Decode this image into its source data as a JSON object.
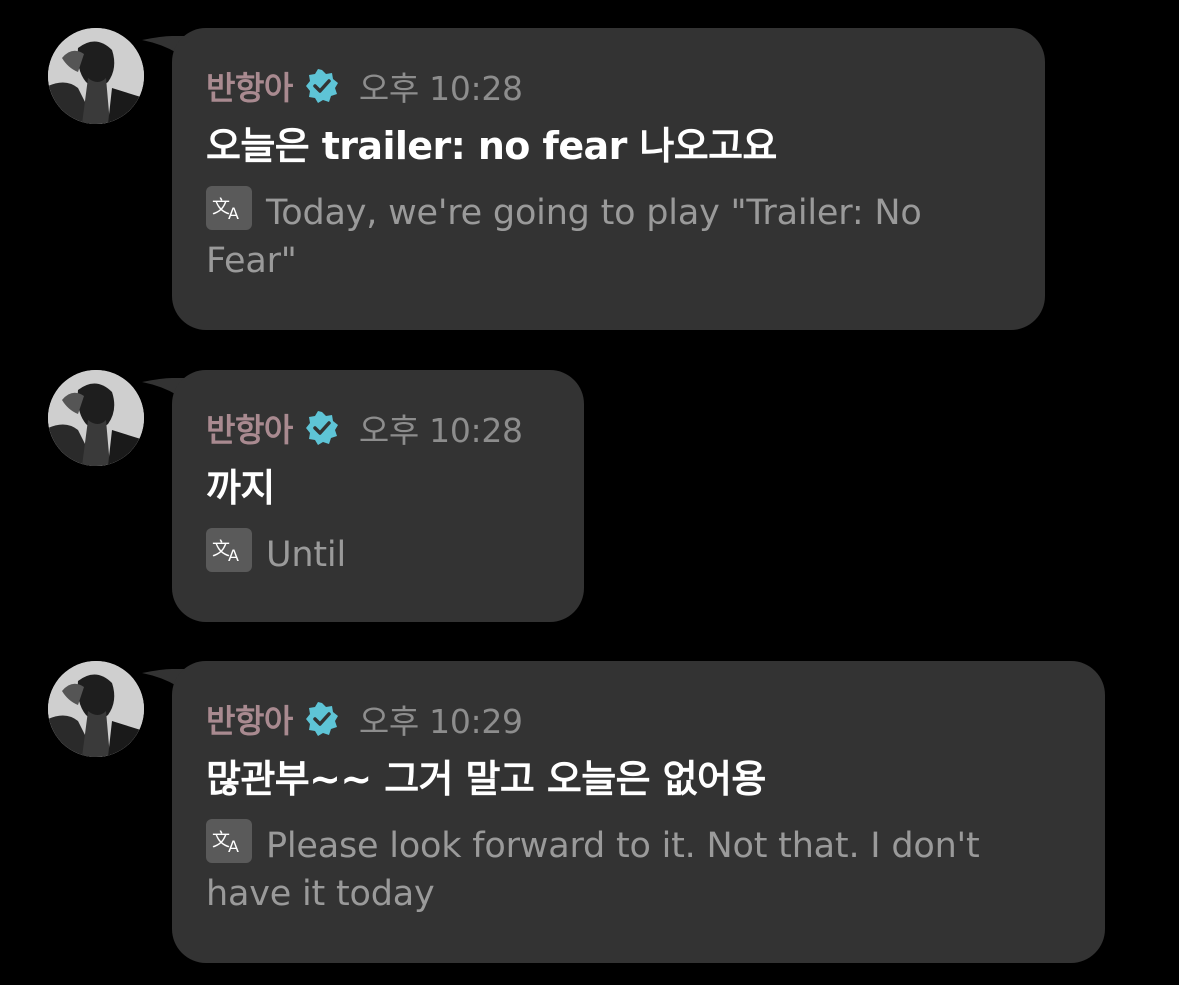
{
  "messages": [
    {
      "sender": "반항아",
      "time": "오후 10:28",
      "text": "오늘은 trailer: no fear 나오고요",
      "translation": "Today, we're going to play \"Trailer: No Fear\"",
      "avatar_icon": "profile-photo"
    },
    {
      "sender": "반항아",
      "time": "오후 10:28",
      "text": "까지",
      "translation": "Until",
      "avatar_icon": "profile-photo"
    },
    {
      "sender": "반항아",
      "time": "오후 10:29",
      "text": "많관부~~ 그거 말고 오늘은 없어용",
      "translation": "Please look forward to it. Not that. I don't have it today",
      "avatar_icon": "profile-photo"
    }
  ],
  "icons": {
    "verified": "verified-badge-icon",
    "translate": "translate-icon"
  },
  "colors": {
    "background": "#000000",
    "bubble": "#333333",
    "sender": "#a98a90",
    "verified": "#5ec4d6",
    "time": "#8d8d8d",
    "text": "#ffffff",
    "translation": "#9a9a9a"
  }
}
